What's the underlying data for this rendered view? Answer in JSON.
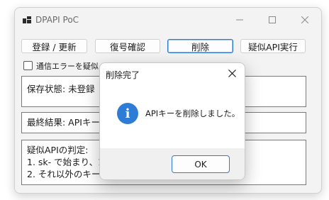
{
  "window": {
    "title": "DPAPI PoC"
  },
  "toolbar": {
    "register_label": "登録 / 更新",
    "verify_label": "復号確認",
    "delete_label": "削除",
    "pseudo_api_label": "疑似API実行"
  },
  "checkbox": {
    "label": "通信エラーを疑似",
    "checked": false
  },
  "main": {
    "storage_status": "保存状態: 未登録",
    "last_result": "最終結果: APIキー",
    "rules": [
      "疑似APIの判定:",
      "1. sk- で始まり、10",
      "2. それ以外のキーは"
    ]
  },
  "dialog": {
    "title": "削除完了",
    "message": "APIキーを削除しました。",
    "ok_label": "OK",
    "icon": "info-icon"
  },
  "colors": {
    "accent": "#2f7cd6"
  }
}
